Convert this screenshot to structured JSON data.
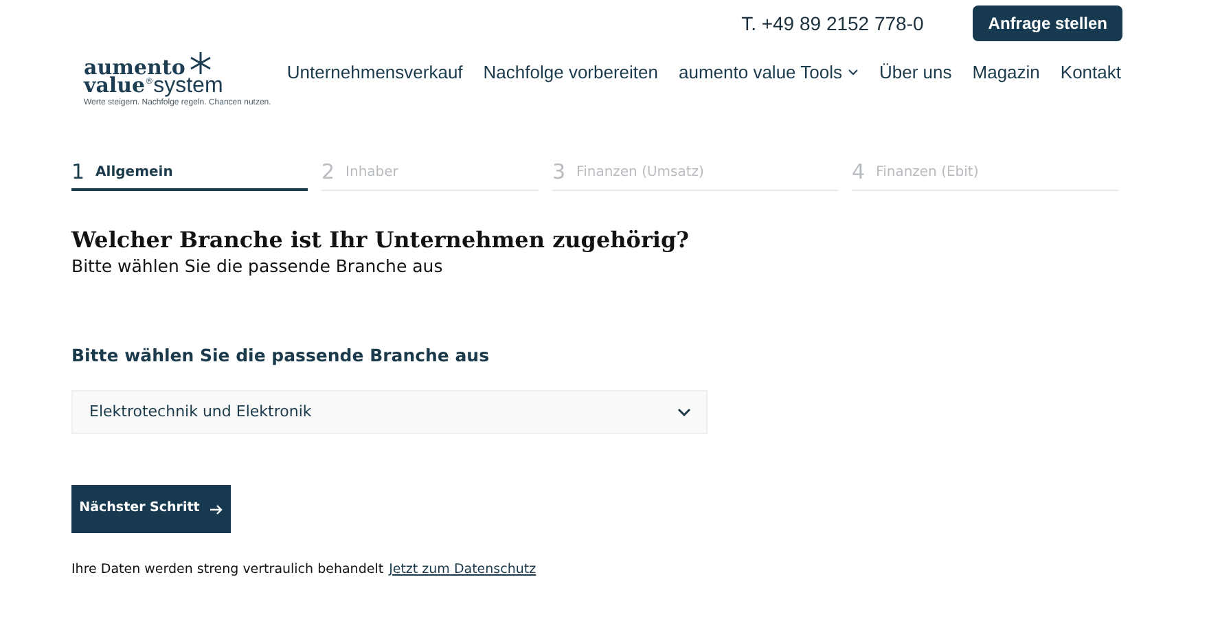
{
  "top_bar": {
    "phone": "T. +49 89 2152 778-0",
    "cta": "Anfrage stellen"
  },
  "logo": {
    "word_1": "aumento",
    "word_2": "value",
    "mark": "®",
    "word_3": "system",
    "tagline": "Werte steigern. Nachfolge regeln. Chancen nutzen."
  },
  "nav": [
    {
      "label": "Unternehmensverkauf",
      "kind": "link"
    },
    {
      "label": "Nachfolge vorbereiten",
      "kind": "link"
    },
    {
      "label": "aumento value Tools",
      "kind": "dropdown"
    },
    {
      "label": "Über uns",
      "kind": "link"
    },
    {
      "label": "Magazin",
      "kind": "link"
    },
    {
      "label": "Kontakt",
      "kind": "link"
    }
  ],
  "steps": [
    {
      "number": "1",
      "label": "Allgemein",
      "selected": true
    },
    {
      "number": "2",
      "label": "Inhaber",
      "selected": false
    },
    {
      "number": "3",
      "label": "Finanzen (Umsatz)",
      "selected": false
    },
    {
      "number": "4",
      "label": "Finanzen (Ebit)",
      "selected": false
    }
  ],
  "question": {
    "title": "Welcher Branche ist Ihr Unternehmen zugehörig?",
    "subtitle": "Bitte wählen Sie die passende Branche aus"
  },
  "field": {
    "label": "Bitte wählen Sie die passende Branche aus",
    "value": "Elektrotechnik und Elektronik"
  },
  "next_button": "Nächster Schritt",
  "privacy": {
    "text": "Ihre Daten werden streng vertraulich behandelt",
    "link": "Jetzt zum Datenschutz"
  }
}
